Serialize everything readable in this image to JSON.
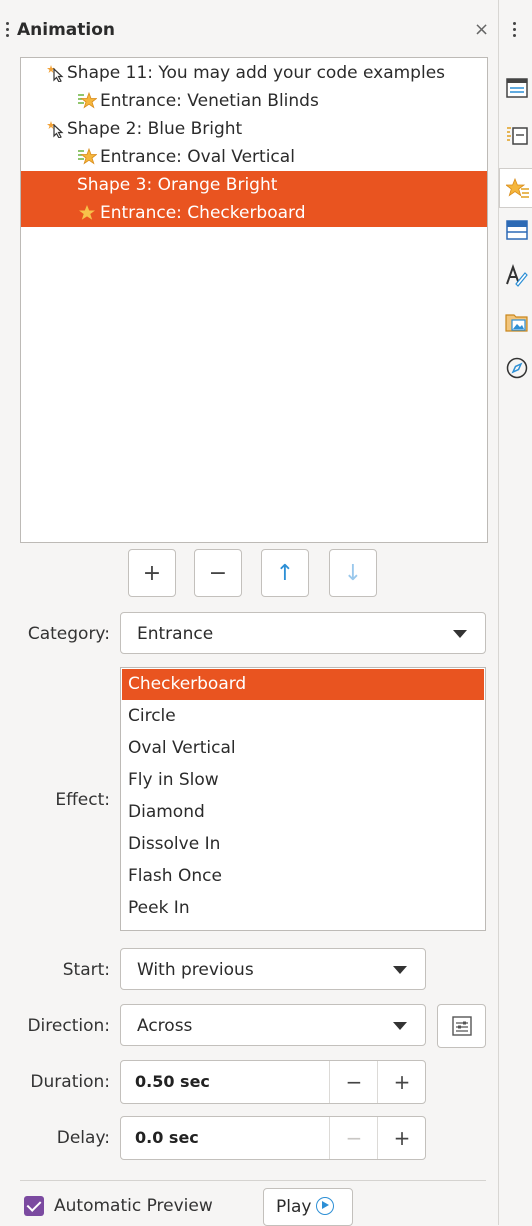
{
  "panel": {
    "title": "Animation",
    "close_glyph": "×"
  },
  "tree": {
    "items": [
      {
        "label": "Shape 11: You may add your code examples",
        "kind": "shape",
        "icon": "cursor-star-icon"
      },
      {
        "label": "Entrance: Venetian Blinds",
        "kind": "effect",
        "icon": "effect-star-icon"
      },
      {
        "label": "Shape 2: Blue Bright",
        "kind": "shape",
        "icon": "cursor-star-icon"
      },
      {
        "label": "Entrance: Oval Vertical",
        "kind": "effect",
        "icon": "effect-star-icon"
      },
      {
        "label": "Shape 3: Orange Bright",
        "kind": "shape",
        "selected": true
      },
      {
        "label": "Entrance: Checkerboard",
        "kind": "effect",
        "icon": "effect-star-icon",
        "selected": true
      }
    ]
  },
  "toolbar": {
    "add": "+",
    "remove": "−",
    "move_up": "↑",
    "move_down": "↓"
  },
  "form": {
    "category_label": "Category:",
    "category_value": "Entrance",
    "effect_label": "Effect:",
    "effects": [
      "Checkerboard",
      "Circle",
      "Oval Vertical",
      "Fly in Slow",
      "Diamond",
      "Dissolve In",
      "Flash Once",
      "Peek In"
    ],
    "effect_selected": "Checkerboard",
    "start_label": "Start:",
    "start_value": "With previous",
    "direction_label": "Direction:",
    "direction_value": "Across",
    "duration_label": "Duration:",
    "duration_value": "0.50 sec",
    "delay_label": "Delay:",
    "delay_value": "0.0 sec",
    "spin_minus": "−",
    "spin_plus": "+"
  },
  "footer": {
    "auto_preview_label": "Automatic Preview",
    "auto_preview_checked": true,
    "play_label": "Play"
  },
  "colors": {
    "accent": "#e95420",
    "checkbox": "#7b4aa0",
    "link_blue": "#2d8fd5"
  }
}
